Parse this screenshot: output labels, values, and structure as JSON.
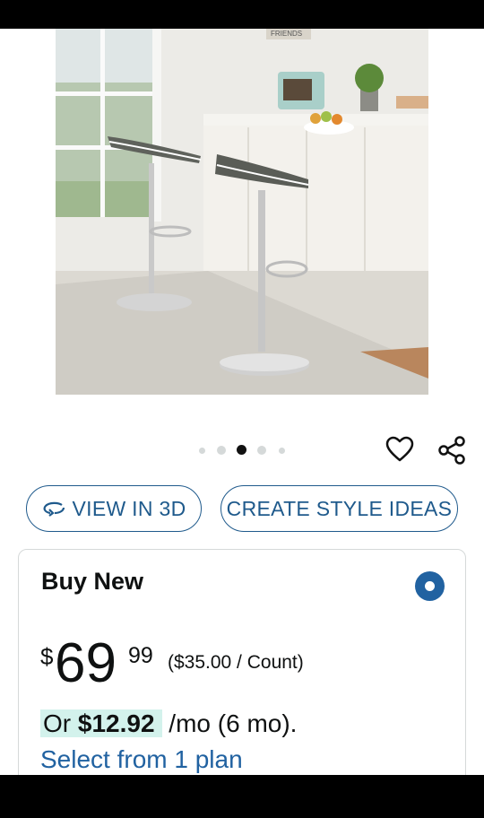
{
  "product": {
    "image_alt": "Two adjustable swivel bar stools in a kitchen",
    "image_sign_text": "FRIENDS",
    "carousel": {
      "count": 5,
      "active_index": 2
    }
  },
  "actions": {
    "wishlist_icon": "heart-outline-icon",
    "share_icon": "share-icon",
    "view_3d_label": "VIEW IN 3D",
    "style_ideas_label": "CREATE STYLE IDEAS"
  },
  "buy_box": {
    "title": "Buy New",
    "selected": true,
    "price_symbol": "$",
    "price_whole": "69",
    "price_fraction": "99",
    "unit_price": "($35.00 / Count)",
    "monthly_prefix": "Or ",
    "monthly_amount": "$12.92",
    "monthly_suffix": " /mo (6 mo).",
    "plan_link": "Select from 1 plan"
  },
  "colors": {
    "link": "#2162a1",
    "pill_border": "#1f5a8c",
    "highlight": "#d3f2ec",
    "text": "#0f1111"
  }
}
